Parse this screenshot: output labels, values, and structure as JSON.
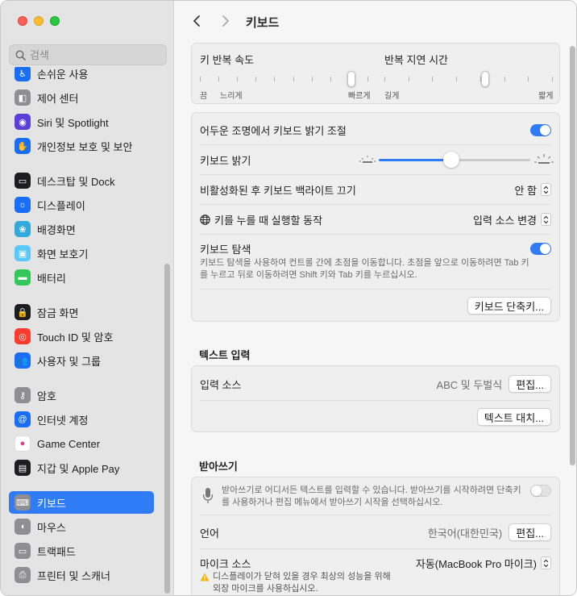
{
  "window": {
    "title": "키보드",
    "back_label": "<",
    "forward_label": ">"
  },
  "search": {
    "placeholder": "검색"
  },
  "sidebar": {
    "items": [
      {
        "label": "손쉬운 사용",
        "icon": "accessibility-icon",
        "color": "#1a6ef5"
      },
      {
        "label": "제어 센터",
        "icon": "control-center-icon",
        "color": "#8e8e93"
      },
      {
        "label": "Siri 및 Spotlight",
        "icon": "siri-icon",
        "color": "#5b3fd9"
      },
      {
        "label": "개인정보 보호 및 보안",
        "icon": "hand-icon",
        "color": "#1a6ef5"
      },
      {
        "label": "데스크탑 및 Dock",
        "icon": "dock-icon",
        "color": "#1d1d1f"
      },
      {
        "label": "디스플레이",
        "icon": "display-icon",
        "color": "#1a6ef5"
      },
      {
        "label": "배경화면",
        "icon": "wallpaper-icon",
        "color": "#34aadc"
      },
      {
        "label": "화면 보호기",
        "icon": "screensaver-icon",
        "color": "#5ac8fa"
      },
      {
        "label": "배터리",
        "icon": "battery-icon",
        "color": "#34c759"
      },
      {
        "label": "잠금 화면",
        "icon": "lock-icon",
        "color": "#1d1d1f"
      },
      {
        "label": "Touch ID 및 암호",
        "icon": "fingerprint-icon",
        "color": "#ff3b30"
      },
      {
        "label": "사용자 및 그룹",
        "icon": "users-icon",
        "color": "#1a6ef5"
      },
      {
        "label": "암호",
        "icon": "key-icon",
        "color": "#8e8e93"
      },
      {
        "label": "인터넷 계정",
        "icon": "at-icon",
        "color": "#1a6ef5"
      },
      {
        "label": "Game Center",
        "icon": "game-center-icon",
        "color": "#ffffff"
      },
      {
        "label": "지갑 및 Apple Pay",
        "icon": "wallet-icon",
        "color": "#1d1d1f"
      },
      {
        "label": "키보드",
        "icon": "keyboard-icon",
        "color": "#8e8e93",
        "active": true
      },
      {
        "label": "마우스",
        "icon": "mouse-icon",
        "color": "#8e8e93"
      },
      {
        "label": "트랙패드",
        "icon": "trackpad-icon",
        "color": "#8e8e93"
      },
      {
        "label": "프린터 및 스캐너",
        "icon": "printer-icon",
        "color": "#8e8e93"
      }
    ]
  },
  "keyboard": {
    "repeat_rate_label": "키 반복 속도",
    "repeat_rate_min": "끔",
    "repeat_rate_slow": "느리게",
    "repeat_rate_fast": "빠르게",
    "repeat_rate_value": 0.9,
    "delay_label": "반복 지연 시간",
    "delay_long": "길게",
    "delay_short": "짧게",
    "delay_value": 0.6,
    "low_light_label": "어두운 조명에서 키보드 밝기 조절",
    "low_light_on": true,
    "brightness_label": "키보드 밝기",
    "brightness_value": 0.48,
    "backlight_off_label": "비활성화된 후 키보드 백라이트 끄기",
    "backlight_off_value": "안 함",
    "globe_key_label": "키를 누를 때 실행할 동작",
    "globe_key_value": "입력 소스 변경",
    "nav_label": "키보드 탐색",
    "nav_on": true,
    "nav_desc": "키보드 탐색을 사용하여 컨트롤 간에 초점을 이동합니다. 초점을 앞으로 이동하려면 Tab 키를 누르고 뒤로 이동하려면 Shift 키와 Tab 키를 누르십시오.",
    "shortcuts_button": "키보드 단축키..."
  },
  "text_input": {
    "section_title": "텍스트 입력",
    "input_sources_label": "입력 소스",
    "input_sources_value": "ABC 및 두벌식",
    "edit_button": "편집...",
    "text_replace_button": "텍스트 대치..."
  },
  "dictation": {
    "section_title": "받아쓰기",
    "desc": "받아쓰기로 어디서든 텍스트를 입력할 수 있습니다. 받아쓰기를 시작하려면 단축키를 사용하거나 편집 메뉴에서 받아쓰기 시작을 선택하십시오.",
    "enabled": false,
    "language_label": "언어",
    "language_value": "한국어(대한민국)",
    "language_edit_button": "편집...",
    "mic_label": "마이크 소스",
    "mic_value": "자동(MacBook Pro 마이크)",
    "mic_warning": "디스플레이가 닫혀 있을 경우 최상의 성능을 위해 외장 마이크를 사용하십시오."
  }
}
